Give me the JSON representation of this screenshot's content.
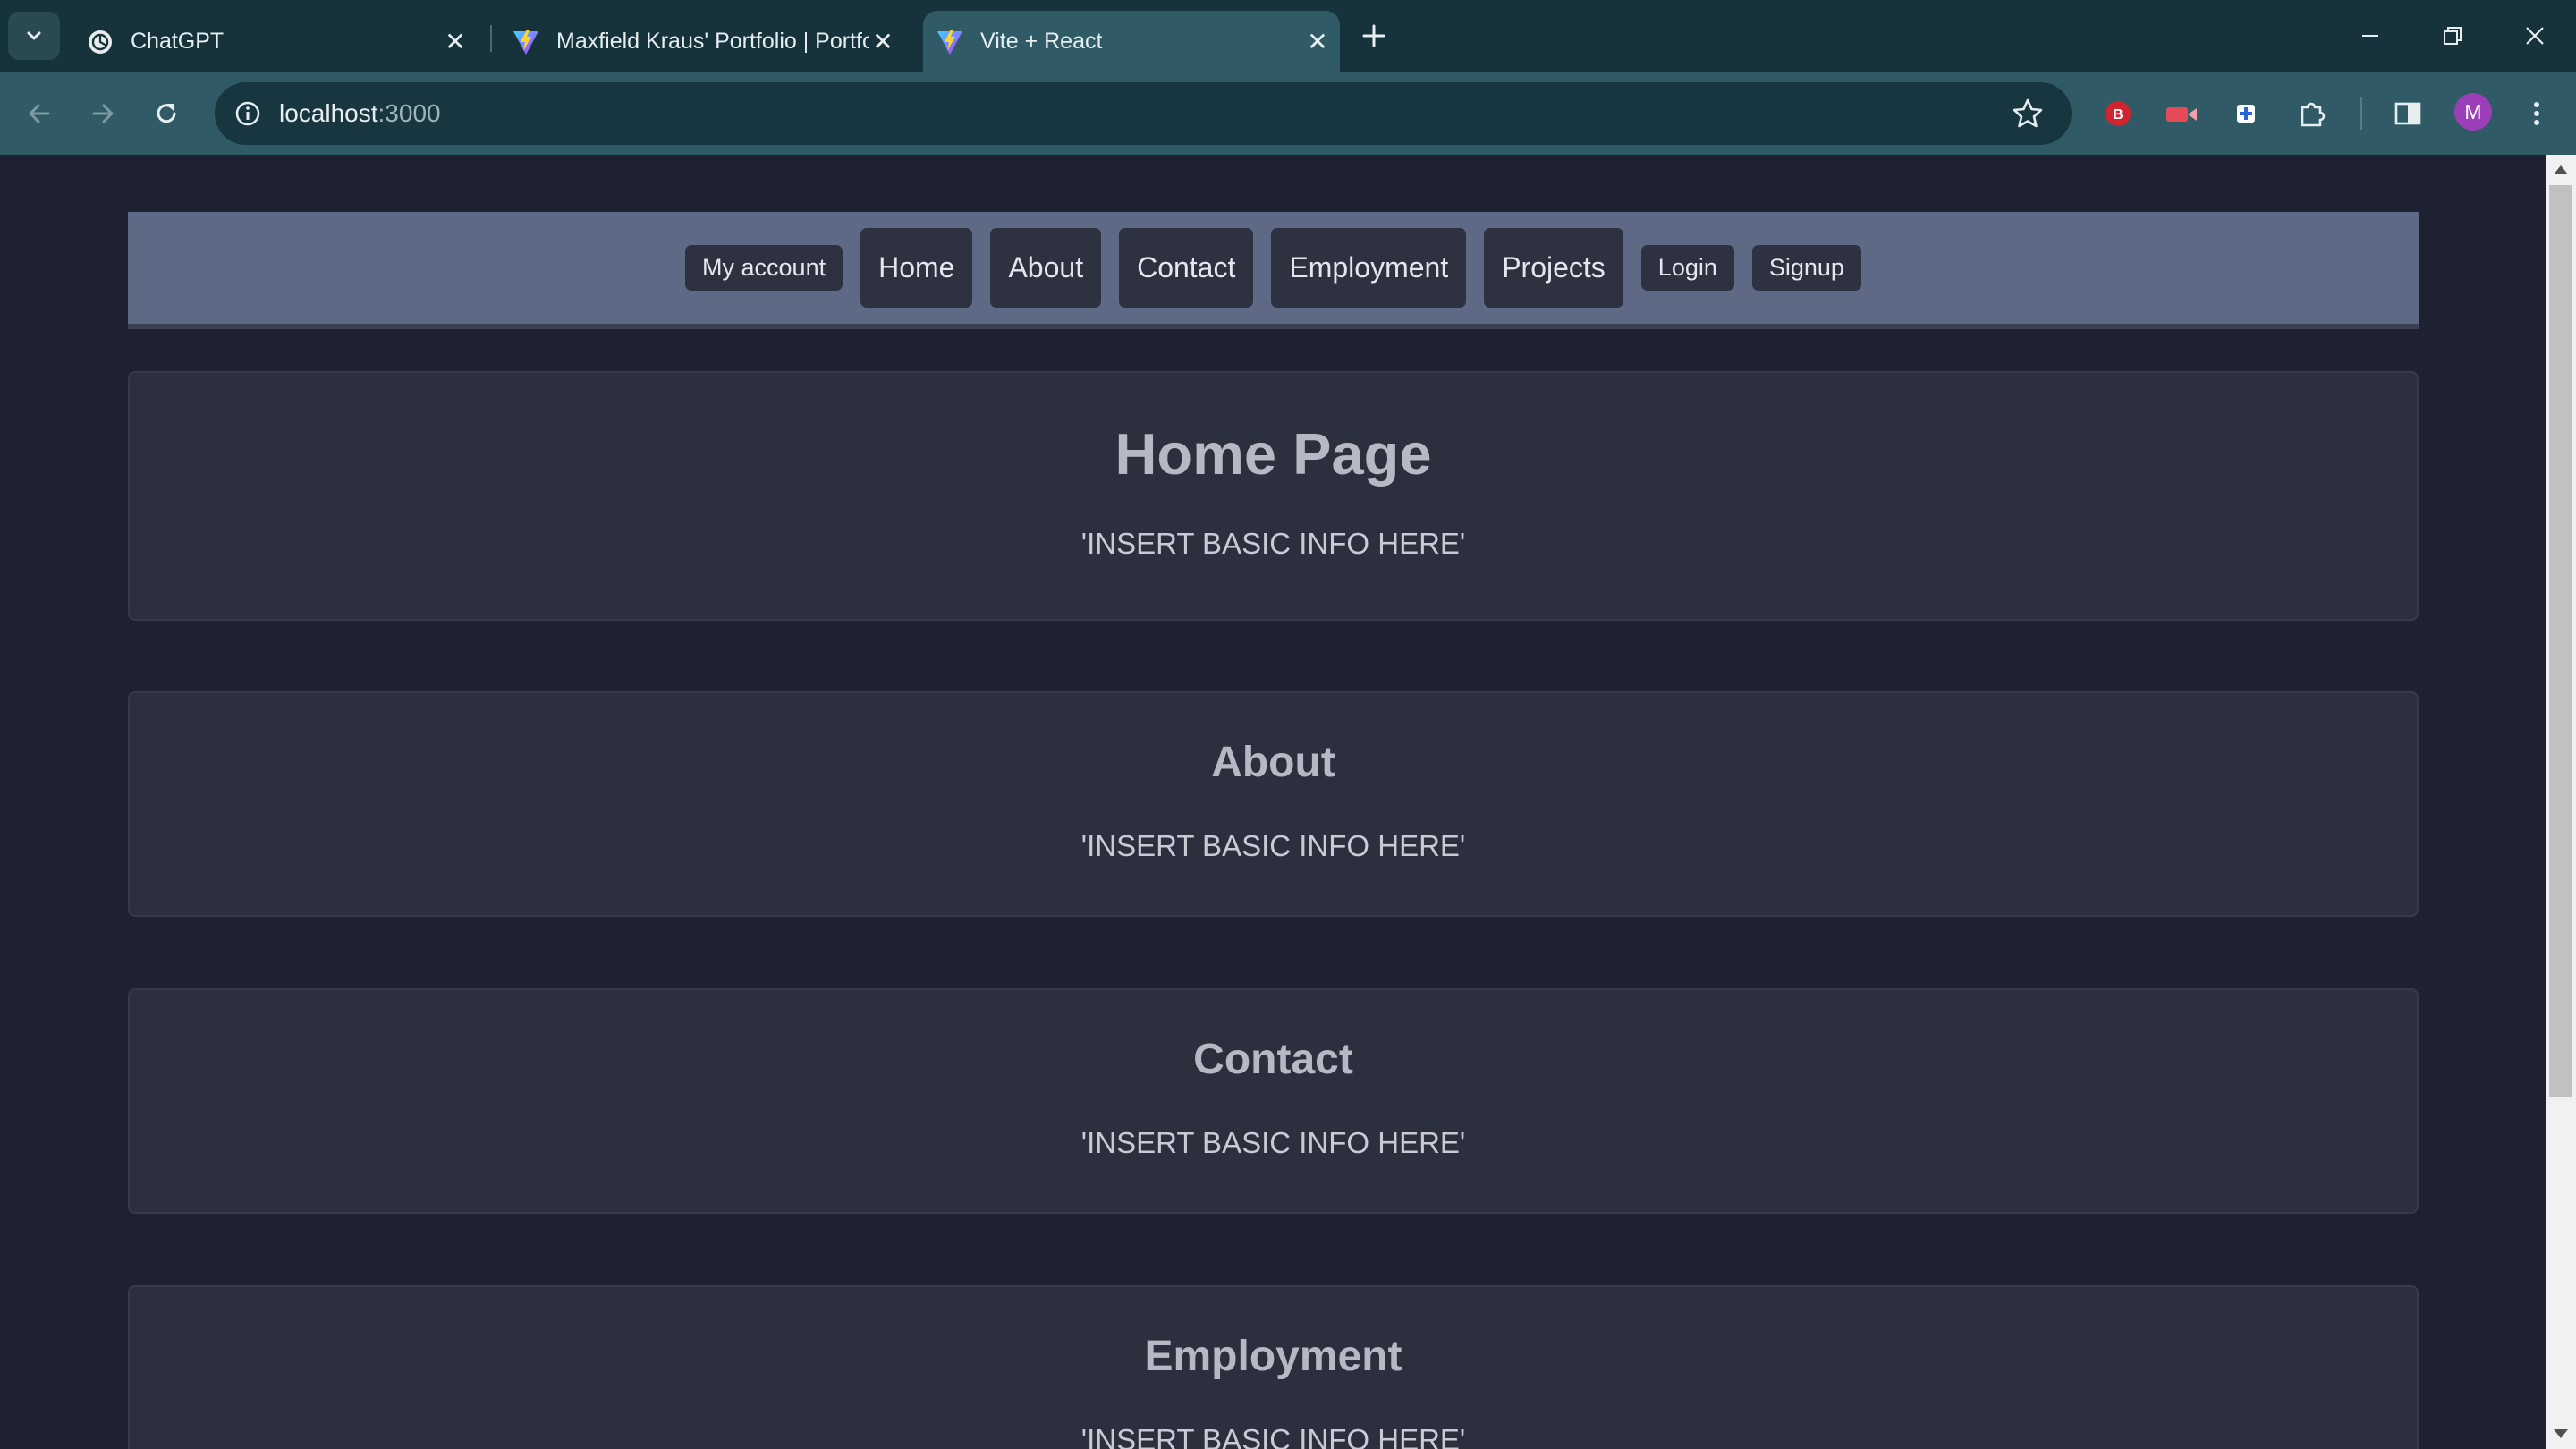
{
  "browser": {
    "tabs": [
      {
        "title": "ChatGPT",
        "favicon": "chatgpt-icon"
      },
      {
        "title": "Maxfield Kraus' Portfolio | Portfolio",
        "favicon": "vite-icon"
      },
      {
        "title": "Vite + React",
        "favicon": "vite-icon",
        "active": true
      }
    ],
    "url_host": "localhost",
    "url_port": ":3000",
    "avatar_initial": "M",
    "extensions": [
      "bitdefender-icon",
      "video-extension-icon",
      "puzzle-extension-icon"
    ]
  },
  "site_nav": {
    "my_account": "My account",
    "home": "Home",
    "about": "About",
    "contact": "Contact",
    "employment": "Employment",
    "projects": "Projects",
    "login": "Login",
    "signup": "Signup"
  },
  "sections": {
    "home": {
      "title": "Home Page",
      "body": "'INSERT BASIC INFO HERE'"
    },
    "about": {
      "title": "About",
      "body": "'INSERT BASIC INFO HERE'"
    },
    "contact": {
      "title": "Contact",
      "body": "'INSERT BASIC INFO HERE'"
    },
    "employment": {
      "title": "Employment",
      "body": "'INSERT BASIC INFO HERE'"
    }
  },
  "colors": {
    "page_bg": "#1e2131",
    "nav_bg": "#5e6a85",
    "card_bg": "#2c2f3d",
    "button_bg": "#2e3140",
    "chrome_tab_bar": "#16333c",
    "chrome_toolbar": "#2f5a66"
  }
}
